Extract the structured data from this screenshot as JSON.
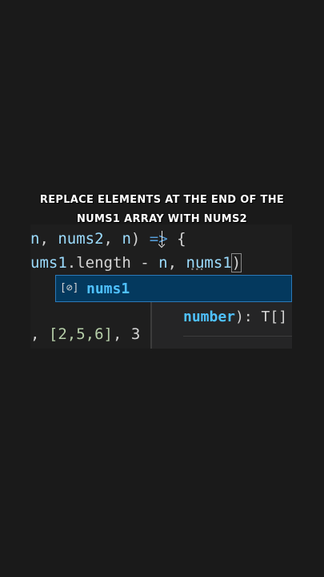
{
  "caption": {
    "line1": "REPLACE ELEMENTS AT THE END OF THE",
    "line2": "NUMS1 ARRAY WITH NUMS2"
  },
  "code": {
    "line1": {
      "a": "n",
      "b": ", ",
      "c": "nums2",
      "d": ", ",
      "e": "n",
      "f": ") ",
      "g": "=>",
      "h": " {"
    },
    "line2": {
      "a": "ums1",
      "b": ".length - ",
      "c": "n",
      "d": ", ",
      "e": "nums1",
      "f": ")"
    },
    "line4": {
      "a": ", ",
      "b": "[2,5,6]",
      "c": ", 3"
    }
  },
  "autocomplete": {
    "icon": "[⊘]",
    "icon_name": "variable-icon",
    "suggestion": "nums1"
  },
  "param_hint": {
    "param": "number",
    "rest": "): T[]"
  },
  "colors": {
    "background": "#1a1a1a",
    "editor_bg": "#1e1e1e",
    "suggest_bg": "#04395e",
    "variable": "#9cdcfe",
    "highlight": "#4fc1ff"
  }
}
